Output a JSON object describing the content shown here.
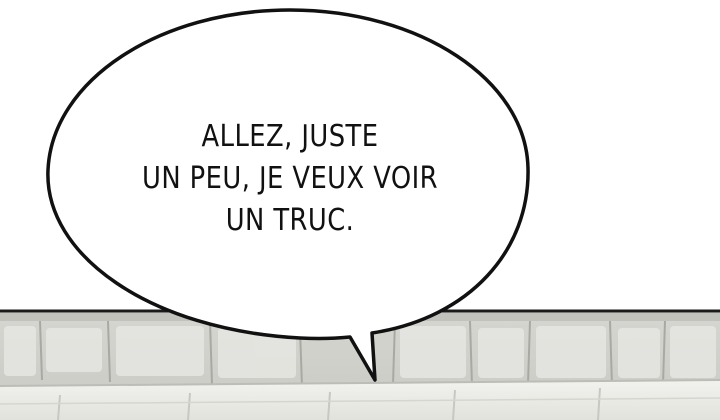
{
  "speech_bubble": {
    "lines": [
      "ALLEZ, JUSTE",
      "UN PEU, JE VEUX VOIR",
      "UN TRUC."
    ]
  },
  "colors": {
    "ink": "#111111",
    "paper": "#ffffff",
    "stone": "#dcdcd8",
    "stone_shadow": "#b9b9b4"
  }
}
